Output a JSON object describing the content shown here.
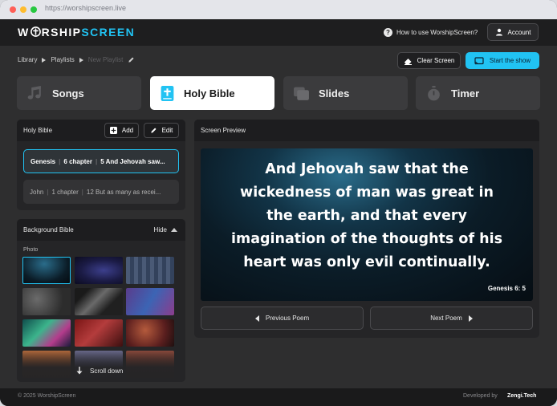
{
  "browser": {
    "url": "https://worshipscreen.live"
  },
  "header": {
    "logo_prefix": "W",
    "logo_mid": "RSHIP",
    "logo_accent": "SCREEN",
    "help_label": "How to use WorshipScreen?",
    "account_label": "Account"
  },
  "breadcrumb": {
    "items": [
      "Library",
      "Playlists",
      "New Playlist"
    ]
  },
  "toolbar": {
    "clear_label": "Clear Screen",
    "start_label": "Start the show"
  },
  "tabs": [
    {
      "label": "Songs",
      "icon": "music-note-icon"
    },
    {
      "label": "Holy Bible",
      "icon": "bible-cross-icon",
      "active": true
    },
    {
      "label": "Slides",
      "icon": "slides-stack-icon"
    },
    {
      "label": "Timer",
      "icon": "stopwatch-icon"
    }
  ],
  "bible_panel": {
    "title": "Holy Bible",
    "add_label": "Add",
    "edit_label": "Edit",
    "verses": [
      {
        "book": "Genesis",
        "chapter": "6 chapter",
        "text": "5 And Jehovah saw...",
        "selected": true
      },
      {
        "book": "John",
        "chapter": "1 chapter",
        "text": "12 But as many as recei...",
        "selected": false
      }
    ]
  },
  "background_panel": {
    "title": "Background Bible",
    "hide_label": "Hide",
    "section_label": "Photo",
    "scroll_label": "Scroll down"
  },
  "preview": {
    "title": "Screen Preview",
    "lines": [
      "And Jehovah saw that the",
      "wickedness of man was great in",
      "the earth, and that every",
      "imagination of the thoughts of his",
      "heart was only evil continually."
    ],
    "reference": "Genesis 6: 5",
    "prev_label": "Previous Poem",
    "next_label": "Next Poem"
  },
  "footer": {
    "copyright": "© 2025 WorshipScreen",
    "dev_label": "Developed by",
    "dev_name": "Zengi.Tech"
  },
  "colors": {
    "accent": "#21c3f3",
    "panel": "#252527",
    "header": "#1e1e1f"
  }
}
